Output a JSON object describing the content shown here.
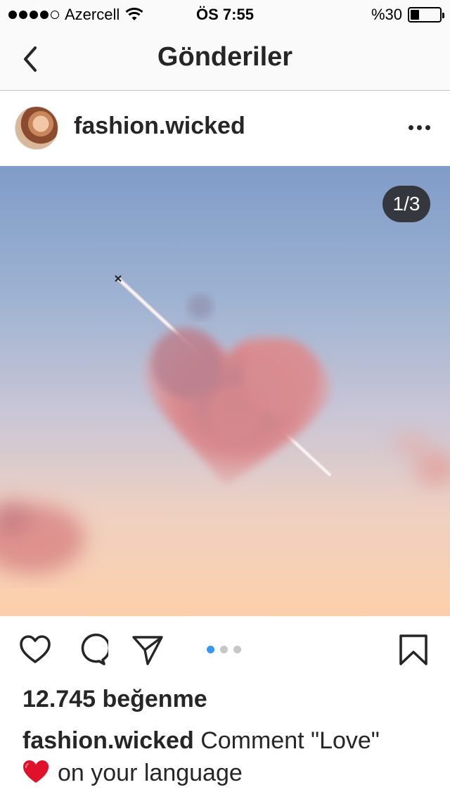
{
  "status_bar": {
    "carrier": "Azercell",
    "time": "ÖS 7:55",
    "battery": "%30",
    "battery_level": 0.3
  },
  "nav": {
    "title": "Gönderiler"
  },
  "post": {
    "username": "fashion.wicked",
    "image_counter": "1/3",
    "pager": {
      "count": 3,
      "active_index": 0
    },
    "likes": "12.745 beğenme",
    "caption_user": "fashion.wicked",
    "caption_text_1": "Comment \"Love\"",
    "caption_text_2": "on your language"
  },
  "icons": {
    "back": "chevron-left-icon",
    "more": "more-horizontal-icon",
    "like": "heart-outline-icon",
    "comment": "comment-bubble-icon",
    "share": "paper-plane-icon",
    "save": "bookmark-icon"
  },
  "colors": {
    "accent": "#3897f0",
    "emoji_heart": "#e0112b"
  }
}
